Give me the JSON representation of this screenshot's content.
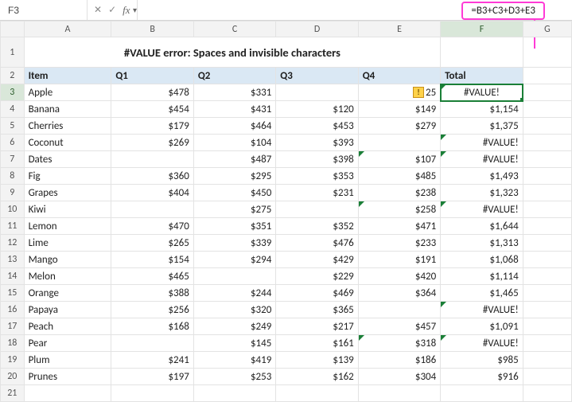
{
  "formula_bar": {
    "cell_ref": "F3",
    "formula": "=B3+C3+D3+E3"
  },
  "columns": [
    "A",
    "B",
    "C",
    "D",
    "E",
    "F",
    "G"
  ],
  "title": "#VALUE error: Spaces and invisible characters",
  "headers": {
    "item": "Item",
    "q1": "Q1",
    "q2": "Q2",
    "q3": "Q3",
    "q4": "Q4",
    "total": "Total"
  },
  "rows": [
    {
      "n": 3,
      "item": "Apple",
      "q1": "$478",
      "q2": "$331",
      "q3": "",
      "q4": "25",
      "q4warn": true,
      "total": "#VALUE!",
      "tri": true,
      "center": true
    },
    {
      "n": 4,
      "item": "Banana",
      "q1": "$454",
      "q2": "$431",
      "q3": "$120",
      "q4": "$149",
      "total": "$1,154"
    },
    {
      "n": 5,
      "item": "Cherries",
      "q1": "$179",
      "q2": "$464",
      "q3": "$453",
      "q4": "$279",
      "total": "$1,375"
    },
    {
      "n": 6,
      "item": "Coconut",
      "q1": "$269",
      "q2": "$104",
      "q3": "$393",
      "q4": "",
      "total": "#VALUE!",
      "tri": true
    },
    {
      "n": 7,
      "item": "Dates",
      "q1": "",
      "q2": "$487",
      "q3": "$398",
      "q4": "$107",
      "q4tri": true,
      "total": "#VALUE!",
      "tri": true
    },
    {
      "n": 8,
      "item": "Fig",
      "q1": "$360",
      "q2": "$295",
      "q3": "$353",
      "q4": "$485",
      "total": "$1,493"
    },
    {
      "n": 9,
      "item": "Grapes",
      "q1": "$404",
      "q2": "$450",
      "q3": "$231",
      "q4": "$238",
      "total": "$1,323"
    },
    {
      "n": 10,
      "item": "Kiwi",
      "q1": "",
      "q2": "$275",
      "q3": "",
      "q4": "$258",
      "q4tri": true,
      "total": "#VALUE!",
      "tri": true
    },
    {
      "n": 11,
      "item": "Lemon",
      "q1": "$470",
      "q2": "$351",
      "q3": "$352",
      "q4": "$471",
      "total": "$1,644"
    },
    {
      "n": 12,
      "item": "Lime",
      "q1": "$265",
      "q2": "$339",
      "q3": "$476",
      "q4": "$233",
      "total": "$1,313"
    },
    {
      "n": 13,
      "item": "Mango",
      "q1": "$154",
      "q2": "$294",
      "q3": "$429",
      "q4": "$191",
      "total": "$1,068"
    },
    {
      "n": 14,
      "item": "Melon",
      "q1": "$465",
      "q2": "",
      "q3": "$229",
      "q4": "$420",
      "total": "$1,114"
    },
    {
      "n": 15,
      "item": "Orange",
      "q1": "$388",
      "q2": "$244",
      "q3": "$469",
      "q4": "$364",
      "total": "$1,465"
    },
    {
      "n": 16,
      "item": "Papaya",
      "q1": "$256",
      "q2": "$320",
      "q3": "$365",
      "q4": "",
      "total": "#VALUE!",
      "tri": true
    },
    {
      "n": 17,
      "item": "Peach",
      "q1": "$168",
      "q2": "$249",
      "q3": "$217",
      "q4": "$457",
      "total": "$1,091"
    },
    {
      "n": 18,
      "item": "Pear",
      "q1": "",
      "q2": "$145",
      "q3": "$161",
      "q4": "$318",
      "q4tri": true,
      "total": "#VALUE!",
      "tri": true
    },
    {
      "n": 19,
      "item": "Plum",
      "q1": "$241",
      "q2": "$419",
      "q3": "$139",
      "q4": "$186",
      "total": "$985"
    },
    {
      "n": 20,
      "item": "Prunes",
      "q1": "$197",
      "q2": "$253",
      "q3": "$162",
      "q4": "$304",
      "total": "$916"
    }
  ],
  "last_empty_row": 21
}
